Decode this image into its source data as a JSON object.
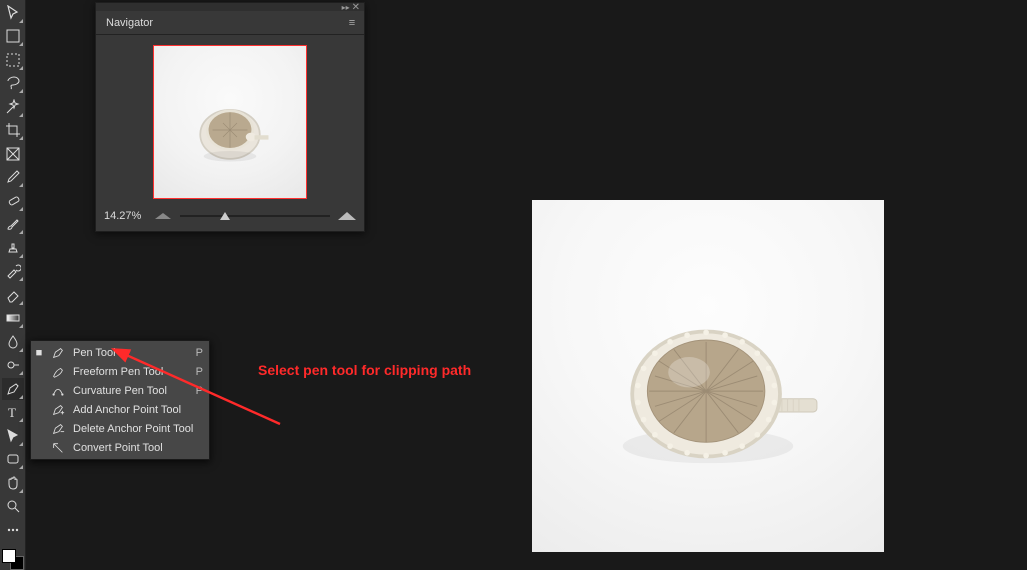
{
  "navigator": {
    "title": "Navigator",
    "zoom": "14.27%"
  },
  "flyout": {
    "items": [
      {
        "label": "Pen Tool",
        "shortcut": "P",
        "icon": "pen-icon",
        "selected": true
      },
      {
        "label": "Freeform Pen Tool",
        "shortcut": "P",
        "icon": "freeform-pen-icon",
        "selected": false
      },
      {
        "label": "Curvature Pen Tool",
        "shortcut": "P",
        "icon": "curvature-pen-icon",
        "selected": false
      },
      {
        "label": "Add Anchor Point Tool",
        "shortcut": "",
        "icon": "add-anchor-icon",
        "selected": false
      },
      {
        "label": "Delete Anchor Point Tool",
        "shortcut": "",
        "icon": "delete-anchor-icon",
        "selected": false
      },
      {
        "label": "Convert Point Tool",
        "shortcut": "",
        "icon": "convert-point-icon",
        "selected": false
      }
    ]
  },
  "annotation": {
    "text": "Select pen tool for clipping path"
  },
  "tools": [
    "move-icon",
    "artboard-icon",
    "marquee-icon",
    "lasso-icon",
    "quick-select-icon",
    "crop-icon",
    "frame-icon",
    "eyedropper-icon",
    "healing-icon",
    "brush-icon",
    "clone-icon",
    "history-brush-icon",
    "eraser-icon",
    "gradient-icon",
    "blur-icon",
    "dodge-icon",
    "pen-icon",
    "type-icon",
    "path-select-icon",
    "shape-icon",
    "hand-icon",
    "zoom-icon",
    "edit-toolbar-icon"
  ],
  "colors": {
    "fg": "#ffffff",
    "bg": "#000000"
  }
}
